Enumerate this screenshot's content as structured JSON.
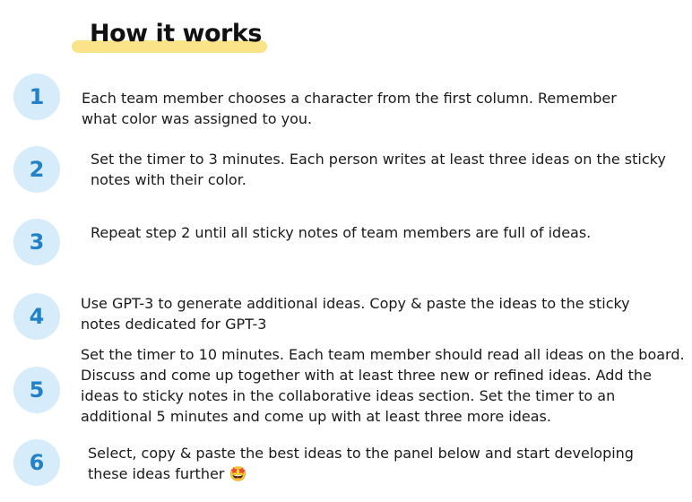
{
  "title": "How it works",
  "steps": [
    {
      "number": "1",
      "text": "Each team member chooses a character from the first column. Remember what color was assigned to you."
    },
    {
      "number": "2",
      "text": "Set the timer to 3 minutes. Each person writes at least three ideas on the sticky notes with their color."
    },
    {
      "number": "3",
      "text": "Repeat step 2 until all sticky notes of team members are full of ideas."
    },
    {
      "number": "4",
      "text": "Use GPT-3 to generate additional ideas. Copy & paste the ideas to the sticky notes dedicated for GPT-3"
    },
    {
      "number": "5",
      "text": "Set the timer to 10 minutes. Each team member should read all ideas on the board. Discuss and come up together with at least three new or refined ideas. Add the ideas to sticky notes in the collaborative ideas section. Set the timer to an additional 5 minutes and come up with at least three more ideas."
    },
    {
      "number": "6",
      "text": "Select, copy & paste the best ideas to the panel below and start developing these ideas further",
      "emoji": "🤩"
    }
  ],
  "colors": {
    "highlight": "#fbe38a",
    "badge_background": "#d6ecfb",
    "badge_number": "#2381c9"
  }
}
